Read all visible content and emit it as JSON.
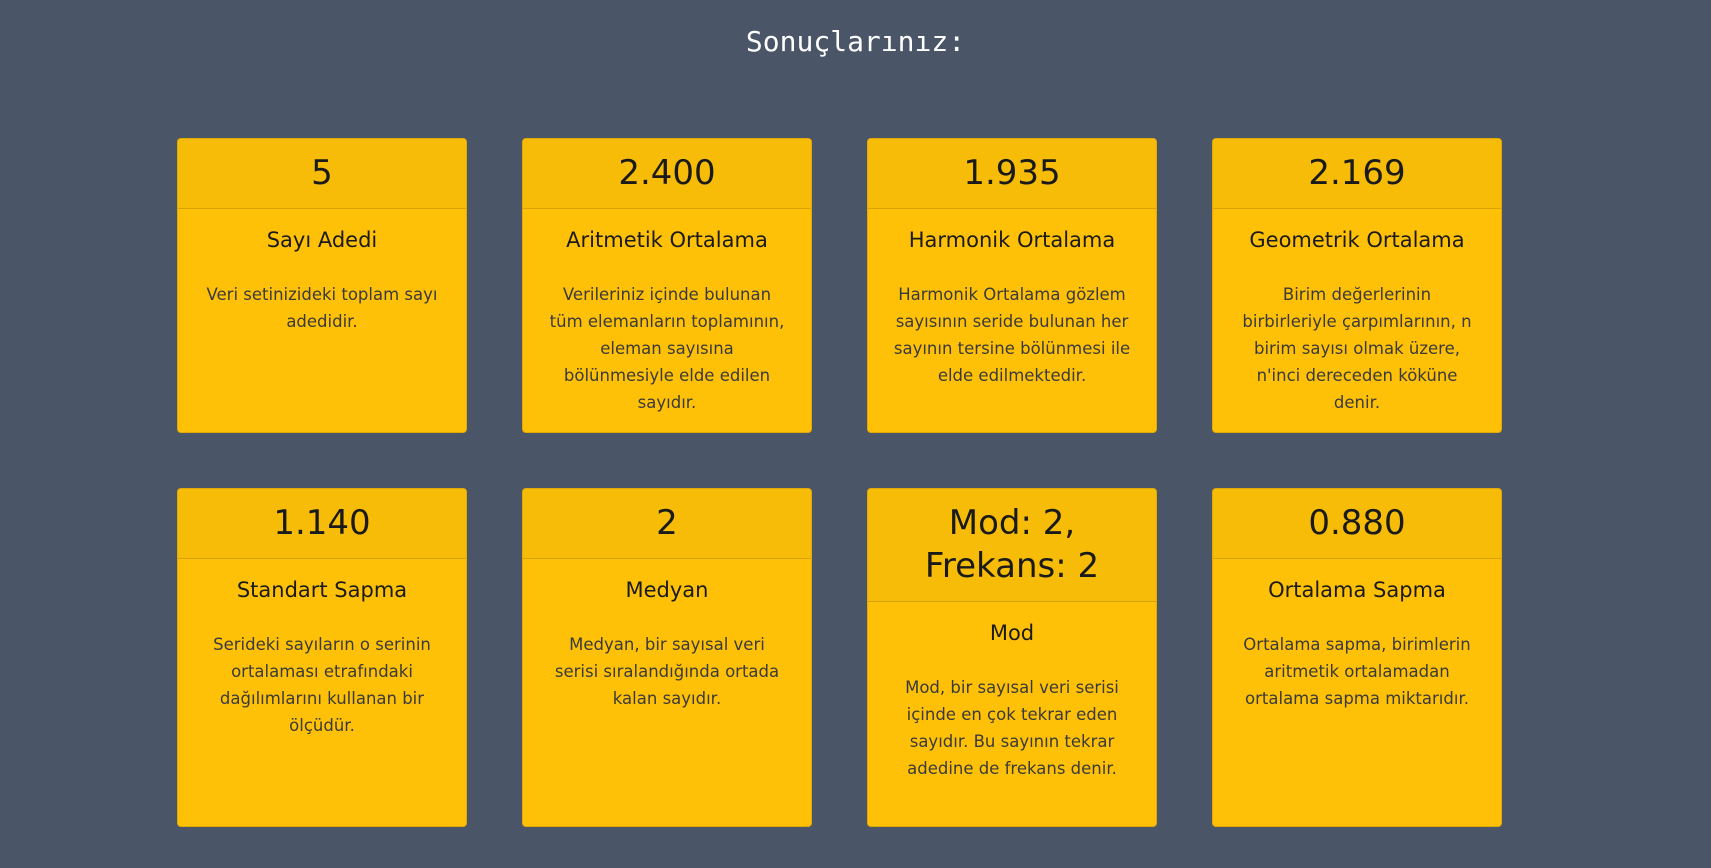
{
  "page": {
    "title": "Sonuçlarınız:"
  },
  "cards": [
    {
      "value": "5",
      "title": "Sayı Adedi",
      "description": "Veri setinizideki toplam sayı adedidir."
    },
    {
      "value": "2.400",
      "title": "Aritmetik Ortalama",
      "description": "Verileriniz içinde bulunan tüm elemanların toplamının, eleman sayısına bölünmesiyle elde edilen sayıdır."
    },
    {
      "value": "1.935",
      "title": "Harmonik Ortalama",
      "description": "Harmonik Ortalama gözlem sayısının seride bulunan her sayının tersine bölünmesi ile elde edilmektedir."
    },
    {
      "value": "2.169",
      "title": "Geometrik Ortalama",
      "description": "Birim değerlerinin birbirleriyle çarpımlarının, n birim sayısı olmak üzere, n'inci dereceden köküne denir."
    },
    {
      "value": "1.140",
      "title": "Standart Sapma",
      "description": "Serideki sayıların o serinin ortalaması etrafındaki dağılımlarını kullanan bir ölçüdür."
    },
    {
      "value": "2",
      "title": "Medyan",
      "description": "Medyan, bir sayısal veri serisi sıralandığında ortada kalan sayıdır."
    },
    {
      "value": "Mod: 2, Frekans: 2",
      "title": "Mod",
      "description": "Mod, bir sayısal veri serisi içinde en çok tekrar eden sayıdır. Bu sayının tekrar adedine de frekans denir."
    },
    {
      "value": "0.880",
      "title": "Ortalama Sapma",
      "description": "Ortalama sapma, birimlerin aritmetik ortalamadan ortalama sapma miktarıdır."
    }
  ]
}
